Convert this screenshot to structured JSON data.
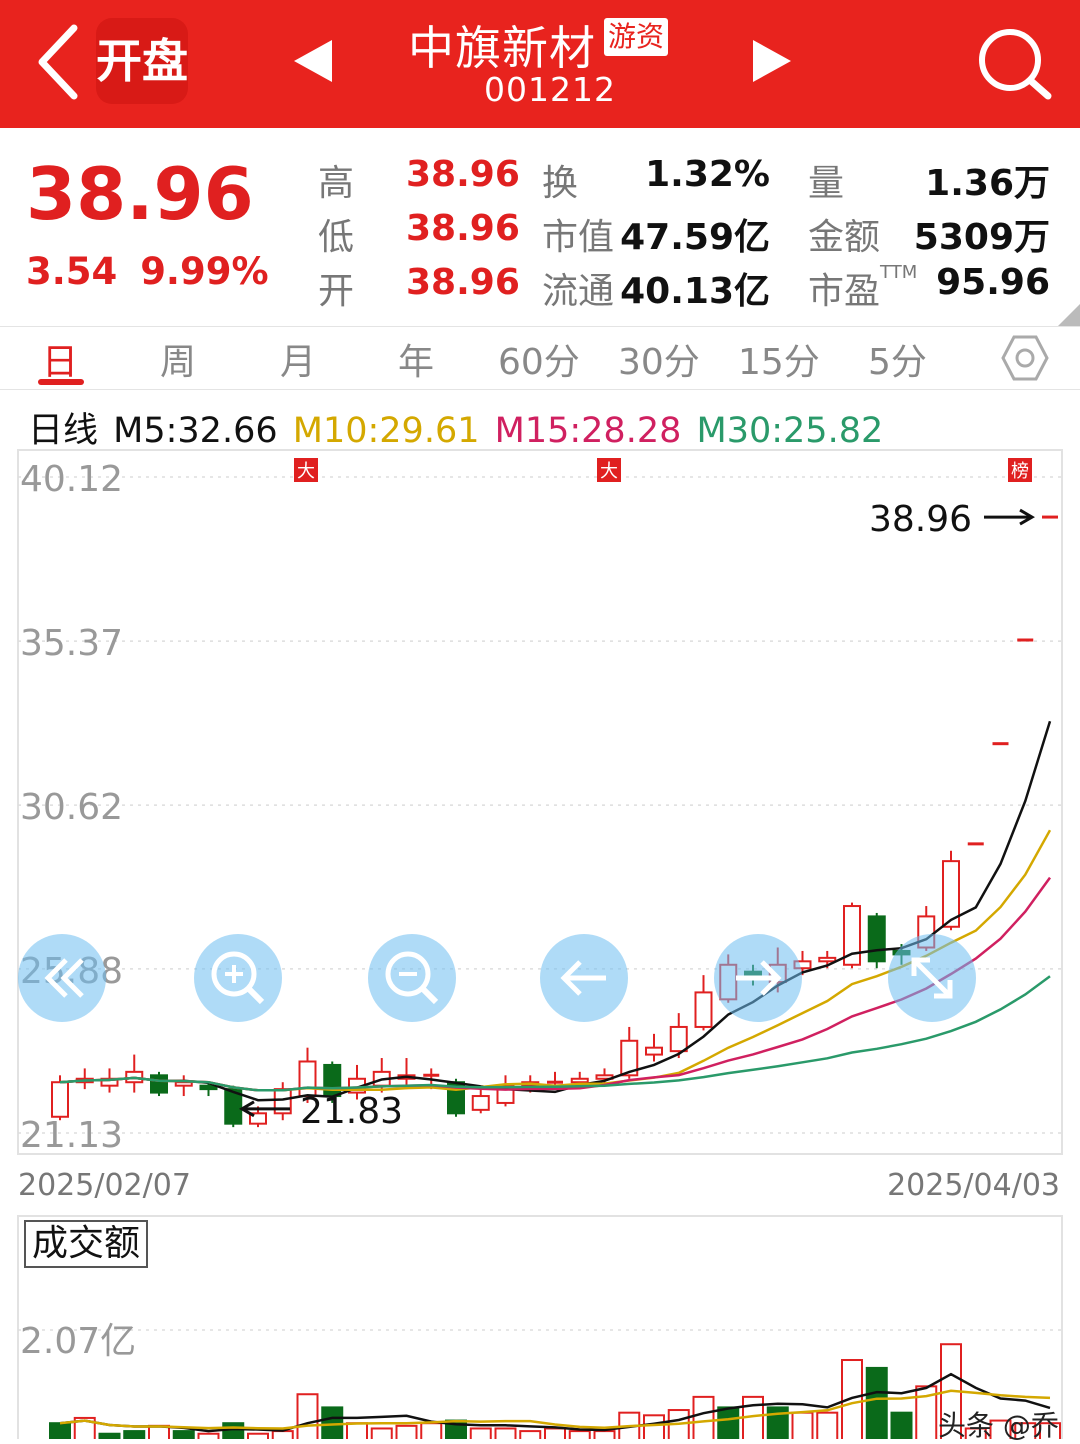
{
  "header": {
    "open_label": "开盘",
    "stock_name": "中旗新材",
    "tag": "游资",
    "stock_code": "001212"
  },
  "quote": {
    "price": "38.96",
    "change": "3.54",
    "change_pct": "9.99%",
    "rows": [
      {
        "l1": "高",
        "v1": "38.96",
        "l2": "换",
        "v2": "1.32%",
        "l3": "量",
        "v3": "1.36万"
      },
      {
        "l1": "低",
        "v1": "38.96",
        "l2": "市值",
        "v2": "47.59亿",
        "l3": "金额",
        "v3": "5309万"
      },
      {
        "l1": "开",
        "v1": "38.96",
        "l2": "流通",
        "v2": "40.13亿",
        "l3": "市盈",
        "l3sup": "TTM",
        "v3": "95.96"
      }
    ]
  },
  "tabs": [
    "日",
    "周",
    "月",
    "年",
    "60分",
    "30分",
    "15分",
    "5分"
  ],
  "ma": {
    "prefix": "日线",
    "m5": "M5:32.66",
    "m10": "M10:29.61",
    "m15": "M15:28.28",
    "m30": "M30:25.82",
    "colors": {
      "m5": "#111111",
      "m10": "#d4a800",
      "m15": "#d02060",
      "m30": "#2a9a6a"
    }
  },
  "colors": {
    "up": "#e02020",
    "down": "#0a6a1a",
    "header": "#e8231e"
  },
  "chart_data": [
    {
      "type": "candlestick",
      "y_ticks": [
        "40.12",
        "35.37",
        "30.62",
        "25.88",
        "21.13"
      ],
      "ylim": [
        21.13,
        40.12
      ],
      "x_start": "2025/02/07",
      "x_end": "2025/04/03",
      "annotations": {
        "high": "38.96",
        "low": "21.83",
        "markers": [
          "大",
          "大",
          "榜"
        ]
      },
      "candles": [
        [
          21.6,
          22.6,
          21.5,
          22.8
        ],
        [
          22.6,
          22.7,
          22.4,
          23.0
        ],
        [
          22.5,
          22.7,
          22.3,
          23.0
        ],
        [
          22.6,
          22.9,
          22.3,
          23.4
        ],
        [
          22.8,
          22.3,
          22.2,
          22.9
        ],
        [
          22.5,
          22.6,
          22.2,
          22.8
        ],
        [
          22.5,
          22.4,
          22.2,
          22.6
        ],
        [
          22.4,
          21.4,
          21.3,
          22.5
        ],
        [
          21.4,
          21.7,
          21.3,
          21.9
        ],
        [
          21.7,
          22.4,
          21.5,
          22.6
        ],
        [
          22.2,
          23.2,
          22.0,
          23.6
        ],
        [
          23.1,
          22.2,
          22.0,
          23.2
        ],
        [
          22.3,
          22.7,
          22.1,
          23.1
        ],
        [
          22.5,
          22.9,
          22.3,
          23.3
        ],
        [
          22.7,
          22.8,
          22.4,
          23.3
        ],
        [
          22.8,
          22.8,
          22.4,
          23.0
        ],
        [
          22.6,
          21.7,
          21.6,
          22.7
        ],
        [
          21.8,
          22.2,
          21.7,
          22.5
        ],
        [
          22.0,
          22.5,
          21.9,
          22.8
        ],
        [
          22.5,
          22.6,
          22.3,
          22.8
        ],
        [
          22.6,
          22.6,
          22.4,
          22.9
        ],
        [
          22.6,
          22.7,
          22.4,
          22.9
        ],
        [
          22.7,
          22.8,
          22.5,
          23.0
        ],
        [
          22.8,
          23.8,
          22.7,
          24.2
        ],
        [
          23.4,
          23.6,
          23.2,
          24.0
        ],
        [
          23.5,
          24.2,
          23.3,
          24.6
        ],
        [
          24.2,
          25.2,
          24.1,
          25.7
        ],
        [
          25.0,
          26.0,
          24.9,
          26.3
        ],
        [
          25.8,
          25.6,
          25.4,
          26.0
        ],
        [
          25.5,
          26.0,
          25.2,
          26.5
        ],
        [
          25.9,
          26.1,
          25.7,
          26.4
        ],
        [
          26.1,
          26.2,
          25.9,
          26.4
        ],
        [
          26.0,
          27.7,
          25.9,
          27.8
        ],
        [
          27.4,
          26.1,
          25.9,
          27.5
        ],
        [
          26.4,
          26.3,
          26.0,
          26.6
        ],
        [
          26.5,
          27.4,
          26.4,
          27.7
        ],
        [
          27.1,
          29.0,
          27.0,
          29.3
        ],
        [
          29.5,
          29.5,
          29.5,
          29.5
        ],
        [
          32.4,
          32.4,
          32.4,
          32.4
        ],
        [
          35.4,
          35.4,
          35.4,
          35.4
        ],
        [
          38.96,
          38.96,
          38.96,
          38.96
        ]
      ]
    },
    {
      "type": "bar",
      "title": "成交额",
      "y_ticks": [
        "2.07亿"
      ],
      "ylim": [
        0,
        2.07
      ],
      "values": [
        0.3,
        0.4,
        0.1,
        0.15,
        0.25,
        0.15,
        0.1,
        0.3,
        0.1,
        0.15,
        0.85,
        0.6,
        0.3,
        0.2,
        0.25,
        0.3,
        0.35,
        0.2,
        0.2,
        0.15,
        0.2,
        0.15,
        0.15,
        0.5,
        0.45,
        0.55,
        0.8,
        0.6,
        0.8,
        0.6,
        0.5,
        0.5,
        1.5,
        1.35,
        0.5,
        1.0,
        1.8,
        0.2,
        0.35,
        0.3,
        0.3
      ],
      "down": [
        1,
        0,
        1,
        1,
        0,
        1,
        0,
        1,
        0,
        0,
        0,
        1,
        0,
        0,
        0,
        0,
        1,
        0,
        0,
        0,
        0,
        0,
        0,
        0,
        0,
        0,
        0,
        1,
        0,
        1,
        0,
        0,
        0,
        1,
        1,
        0,
        0,
        0,
        0,
        0,
        0
      ]
    }
  ],
  "watermark": "头条 @乔"
}
